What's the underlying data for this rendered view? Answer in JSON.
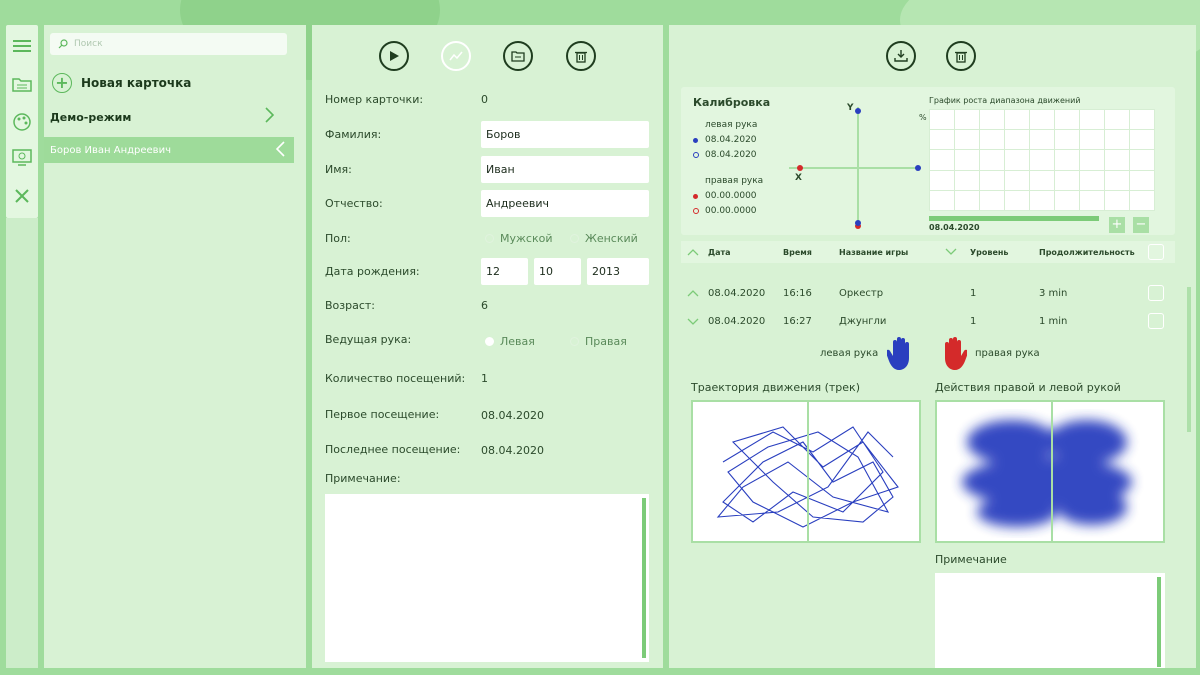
{
  "sidebar": {
    "search_placeholder": "Поиск",
    "new_card_label": "Новая карточка",
    "demo_label": "Демо-режим",
    "selected_person": "Боров Иван Андреевич"
  },
  "card": {
    "number_label": "Номер карточки:",
    "number_value": "0",
    "surname_label": "Фамилия:",
    "surname_value": "Боров",
    "name_label": "Имя:",
    "name_value": "Иван",
    "patronymic_label": "Отчество:",
    "patronymic_value": "Андреевич",
    "sex_label": "Пол:",
    "sex_male": "Мужской",
    "sex_female": "Женский",
    "dob_label": "Дата рождения:",
    "dob_day": "12",
    "dob_month": "10",
    "dob_year": "2013",
    "age_label": "Возраст:",
    "age_value": "6",
    "hand_label": "Ведущая рука:",
    "hand_left": "Левая",
    "hand_right": "Правая",
    "visits_label": "Количество посещений:",
    "visits_value": "1",
    "first_visit_label": "Первое посещение:",
    "first_visit_value": "08.04.2020",
    "last_visit_label": "Последнее посещение:",
    "last_visit_value": "08.04.2020",
    "note_label": "Примечание:"
  },
  "calibration": {
    "title": "Калибровка",
    "left_hand_label": "левая рука",
    "left_dates": [
      "08.04.2020",
      "08.04.2020"
    ],
    "right_hand_label": "правая рука",
    "right_dates": [
      "00.00.0000",
      "00.00.0000"
    ],
    "axis_y": "Y",
    "axis_x": "X",
    "graph_title": "График роста диапазона движений",
    "graph_unit": "%",
    "graph_date": "08.04.2020",
    "colors": {
      "left": "#2a3fbf",
      "right": "#d42a2a"
    }
  },
  "sessions": {
    "headers": [
      "Дата",
      "Время",
      "Название игры",
      "Уровень",
      "Продолжительность"
    ],
    "rows": [
      {
        "date": "08.04.2020",
        "time": "16:16",
        "game": "Оркестр",
        "level": "1",
        "duration": "3 min"
      },
      {
        "date": "08.04.2020",
        "time": "16:27",
        "game": "Джунгли",
        "level": "1",
        "duration": "1 min"
      }
    ],
    "left_hand_caption": "левая рука",
    "right_hand_caption": "правая рука",
    "track_title": "Траектория движения (трек)",
    "actions_title": "Действия правой и левой рукой",
    "note_label": "Примечание"
  }
}
